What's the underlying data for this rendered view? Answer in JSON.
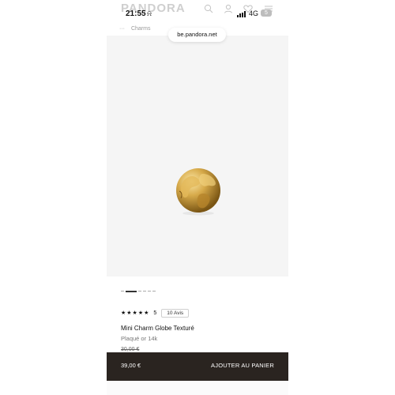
{
  "status": {
    "time": "21:55",
    "network": "4G",
    "battery": "5"
  },
  "header": {
    "brand": "PANDORA",
    "breadcrumb": "Charms",
    "url": "be.pandora.net"
  },
  "product": {
    "rating_stars": "★★★★★",
    "rating_value": "5",
    "reviews_label": "10 Avis",
    "name": "Mini Charm Globe Texturé",
    "material": "Plaqué or 14k",
    "old_price": "30,00 €"
  },
  "cart": {
    "price": "39,00 €",
    "button": "AJOUTER AU PANIER"
  },
  "colors": {
    "bar": "#2a2420",
    "gold": "#c9a24a"
  },
  "icons": [
    "mute-icon",
    "search-icon",
    "user-icon",
    "wishlist-icon",
    "menu-icon",
    "globe-charm-image"
  ]
}
